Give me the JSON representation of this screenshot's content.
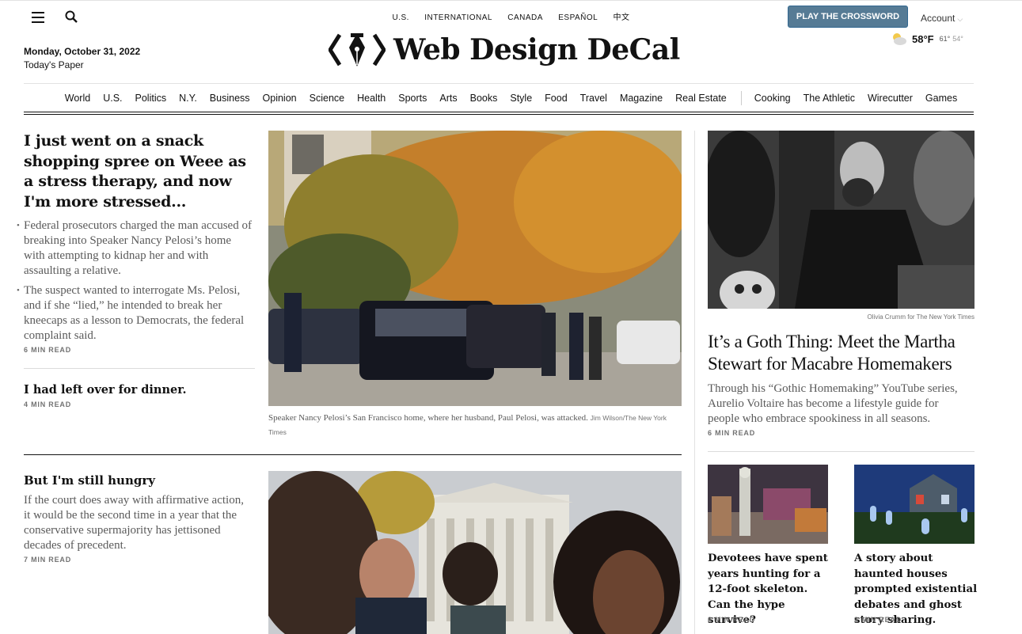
{
  "header": {
    "editions": [
      "U.S.",
      "INTERNATIONAL",
      "CANADA",
      "ESPAÑOL",
      "中文"
    ],
    "crossword_button": "PLAY THE CROSSWORD",
    "account_label": "Account",
    "date": "Monday, October 31, 2022",
    "todays_paper": "Today's Paper",
    "logo_text": "Web Design DeCal",
    "weather": {
      "icon": "partly-cloudy-icon",
      "temp": "58°F",
      "high": "61°",
      "low": "54°"
    }
  },
  "nav": {
    "items": [
      "World",
      "U.S.",
      "Politics",
      "N.Y.",
      "Business",
      "Opinion",
      "Science",
      "Health",
      "Sports",
      "Arts",
      "Books",
      "Style",
      "Food",
      "Travel",
      "Magazine",
      "Real Estate"
    ],
    "extras": [
      "Cooking",
      "The Athletic",
      "Wirecutter",
      "Games"
    ]
  },
  "lead": {
    "headline": "I just went on a snack shopping spree on Weee as a stress therapy, and now I'm more stressed...",
    "bullets": [
      "Federal prosecutors charged the man accused of breaking into Speaker Nancy Pelosi’s home with attempting to kidnap her and with assaulting a relative.",
      "The suspect wanted to interrogate Ms. Pelosi, and if she “lied,” he intended to break her kneecaps as a lesson to Democrats, the federal complaint said."
    ],
    "read_time": "6 MIN READ",
    "caption": "Speaker Nancy Pelosi’s San Francisco home, where her husband, Paul Pelosi, was attacked.",
    "caption_credit": "Jim Wilson/The New York Times"
  },
  "story2": {
    "headline": "I had left over for dinner.",
    "read_time": "4 MIN READ"
  },
  "story3": {
    "headline": "But I'm still hungry",
    "summary": "If the court does away with affirmative action, it would be the second time in a year that the conservative supermajority has jettisoned decades of precedent.",
    "read_time": "7 MIN READ"
  },
  "goth": {
    "credit": "Olivia Crumm for The New York Times",
    "headline": "It’s a Goth Thing: Meet the Martha Stewart for Macabre Homemakers",
    "summary": "Through his “Gothic Homemaking” YouTube series, Aurelio Voltaire has become a lifestyle guide for people who embrace spookiness in all seasons.",
    "read_time": "6 MIN READ"
  },
  "small1": {
    "headline": "Devotees have spent years hunting for a 12-foot skeleton. Can the hype survive?",
    "read_time": "8 MIN READ"
  },
  "small2": {
    "headline": "A story about haunted houses prompted existential debates and ghost story sharing.",
    "read_time": "3 MIN READ"
  }
}
